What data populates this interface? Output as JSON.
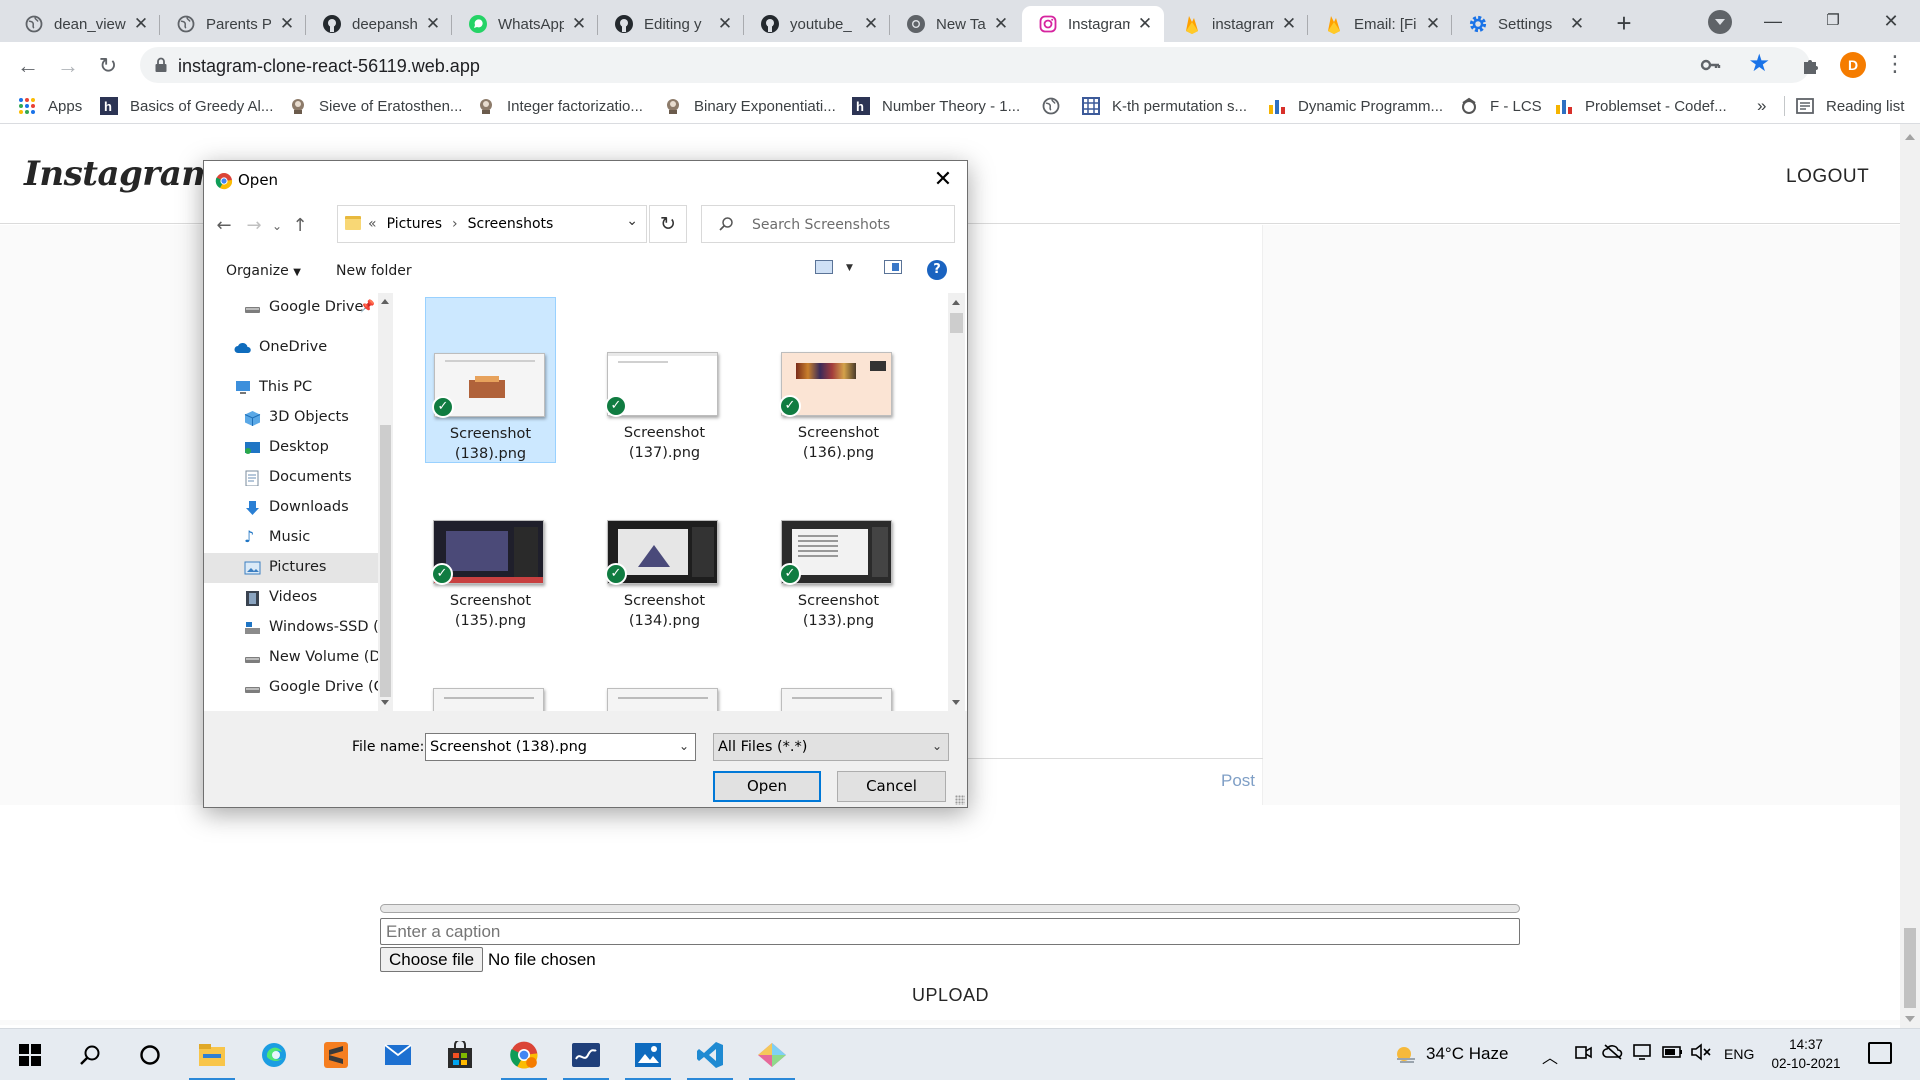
{
  "browser": {
    "tabs": [
      {
        "title": "dean_view",
        "icon": "globe-icon"
      },
      {
        "title": "Parents P",
        "icon": "globe-icon"
      },
      {
        "title": "deepansh",
        "icon": "github-icon"
      },
      {
        "title": "WhatsApp",
        "icon": "whatsapp-icon"
      },
      {
        "title": "Editing y",
        "icon": "github-icon"
      },
      {
        "title": "youtube_",
        "icon": "github-icon"
      },
      {
        "title": "New Tab",
        "icon": "chrome-icon"
      },
      {
        "title": "Instagram",
        "icon": "instagram-icon",
        "active": true
      },
      {
        "title": "instagram",
        "icon": "firebase-icon"
      },
      {
        "title": "Email: [Fi",
        "icon": "firebase-icon"
      },
      {
        "title": "Settings",
        "icon": "settings-gear-icon"
      }
    ],
    "url": "instagram-clone-react-56119.web.app",
    "profile_initial": "D",
    "bookmarks": [
      {
        "label": "Apps",
        "icon": "apps-grid-icon"
      },
      {
        "label": "Basics of Greedy Al...",
        "icon": "h-logo-icon"
      },
      {
        "label": "Sieve of Eratosthen...",
        "icon": "geeks-icon"
      },
      {
        "label": "Integer factorizatio...",
        "icon": "geeks-icon"
      },
      {
        "label": "Binary Exponentiati...",
        "icon": "geeks-icon"
      },
      {
        "label": "Number Theory - 1...",
        "icon": "h-logo-icon"
      },
      {
        "label": "",
        "icon": "globe-icon"
      },
      {
        "label": "K-th permutation s...",
        "icon": "grid-icon"
      },
      {
        "label": "Dynamic Programm...",
        "icon": "bar-chart-icon"
      },
      {
        "label": "F - LCS",
        "icon": "atcoder-icon"
      },
      {
        "label": "Problemset - Codef...",
        "icon": "bar-chart-icon"
      }
    ],
    "bookmarks_overflow": "»",
    "reading_list": "Reading list"
  },
  "app": {
    "logo": "Instagram",
    "logout": "LOGOUT",
    "post_label": "Post",
    "upload": {
      "progress_percent": 0,
      "caption_placeholder": "Enter a caption",
      "choose_file_label": "Choose file",
      "no_file_text": "No file chosen",
      "upload_label": "UPLOAD"
    }
  },
  "dialog": {
    "title": "Open",
    "path": [
      "Pictures",
      "Screenshots"
    ],
    "path_prefix": "«",
    "search_placeholder": "Search Screenshots",
    "organize_label": "Organize",
    "new_folder_label": "New folder",
    "nav_items": [
      {
        "label": "Google Drive",
        "icon": "drive-icon",
        "pinned": true
      },
      {
        "label": "OneDrive",
        "icon": "cloud-icon"
      },
      {
        "label": "This PC",
        "icon": "computer-icon"
      },
      {
        "label": "3D Objects",
        "icon": "cube-icon"
      },
      {
        "label": "Desktop",
        "icon": "desktop-icon"
      },
      {
        "label": "Documents",
        "icon": "document-icon"
      },
      {
        "label": "Downloads",
        "icon": "download-icon"
      },
      {
        "label": "Music",
        "icon": "music-note-icon"
      },
      {
        "label": "Pictures",
        "icon": "picture-icon",
        "selected": true
      },
      {
        "label": "Videos",
        "icon": "film-icon"
      },
      {
        "label": "Windows-SSD (C",
        "icon": "drive-disk-icon"
      },
      {
        "label": "New Volume (D:",
        "icon": "drive-disk-icon"
      },
      {
        "label": "Google Drive (G:",
        "icon": "drive-disk-icon"
      }
    ],
    "files": [
      {
        "name_line1": "Screenshot",
        "name_line2": "(138).png",
        "selected": true,
        "thumb": "light"
      },
      {
        "name_line1": "Screenshot",
        "name_line2": "(137).png",
        "thumb": "blank"
      },
      {
        "name_line1": "Screenshot",
        "name_line2": "(136).png",
        "thumb": "peach"
      },
      {
        "name_line1": "Screenshot",
        "name_line2": "(135).png",
        "thumb": "dark"
      },
      {
        "name_line1": "Screenshot",
        "name_line2": "(134).png",
        "thumb": "dark-triangle"
      },
      {
        "name_line1": "Screenshot",
        "name_line2": "(133).png",
        "thumb": "dark-text"
      }
    ],
    "file_name_label": "File name:",
    "file_name_value": "Screenshot (138).png",
    "file_type_value": "All Files (*.*)",
    "open_label": "Open",
    "cancel_label": "Cancel"
  },
  "taskbar": {
    "apps": [
      "windows-start-icon",
      "search-icon",
      "cortana-icon",
      "file-explorer-icon",
      "edge-icon",
      "sublime-icon",
      "mail-icon",
      "store-icon",
      "chrome-icon",
      "whiteboard-icon",
      "photos-icon",
      "vscode-icon",
      "git-icon"
    ],
    "weather": "34°C  Haze",
    "language": "ENG",
    "time": "14:37",
    "date": "02-10-2021"
  },
  "colors": {
    "accent": "#0078d7",
    "chrome_tabstrip": "#dee1e6",
    "selection": "#cce8ff",
    "check_green": "#107c41"
  }
}
